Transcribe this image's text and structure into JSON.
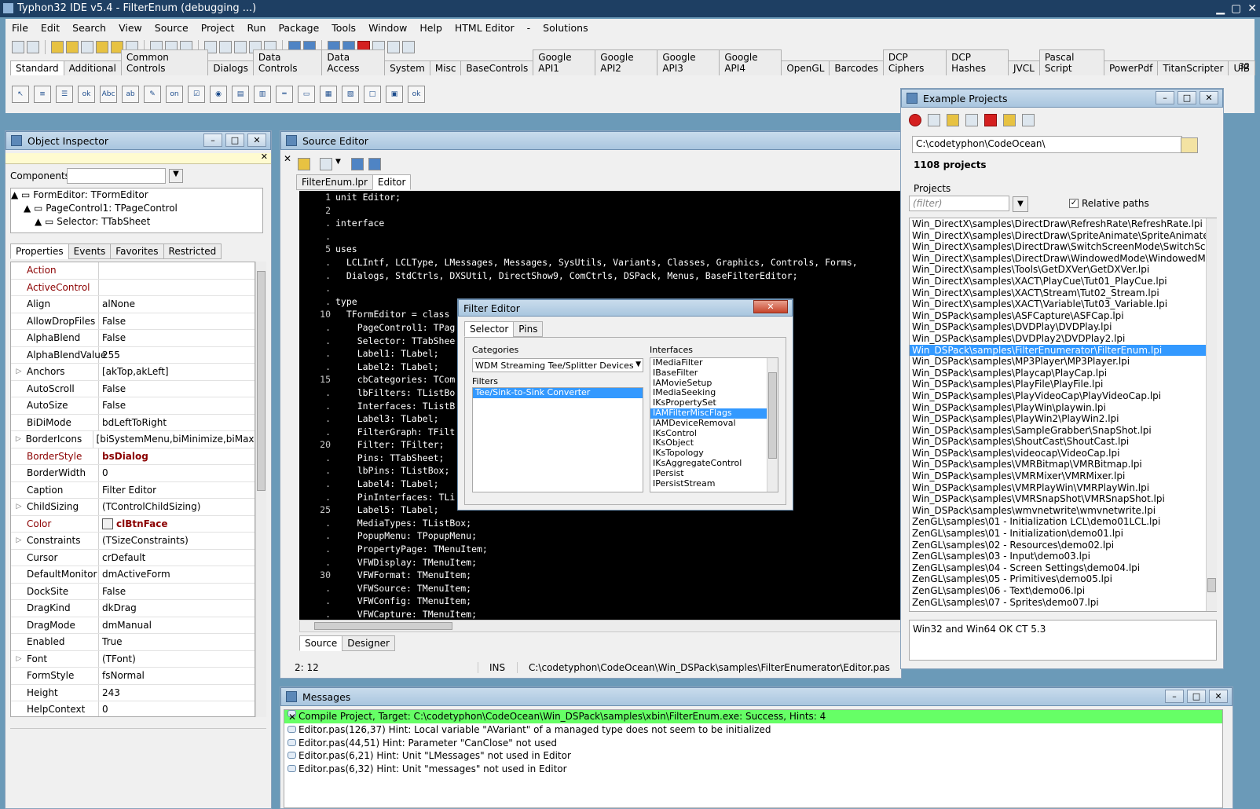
{
  "window_title": "Typhon32 IDE v5.4 - FilterEnum (debugging ...)",
  "menu": [
    "File",
    "Edit",
    "Search",
    "View",
    "Source",
    "Project",
    "Run",
    "Package",
    "Tools",
    "Window",
    "Help",
    "HTML Editor",
    "-",
    "Solutions"
  ],
  "component_tabs": [
    "Standard",
    "Additional",
    "Common Controls",
    "Dialogs",
    "Data Controls",
    "Data Access",
    "System",
    "Misc",
    "BaseControls",
    "Google API1",
    "Google API2",
    "Google API3",
    "Google API4",
    "OpenGL",
    "Barcodes",
    "DCP Ciphers",
    "DCP Hashes",
    "JVCL",
    "Pascal Script",
    "PowerPdf",
    "TitanScripter",
    "UIB"
  ],
  "side_number": "32",
  "object_inspector": {
    "title": "Object Inspector",
    "components_label": "Components",
    "tree": [
      "FormEditor: TFormEditor",
      "PageControl1: TPageControl",
      "Selector: TTabSheet"
    ],
    "tabs": [
      "Properties",
      "Events",
      "Favorites",
      "Restricted"
    ],
    "props": [
      {
        "name": "Action",
        "value": "",
        "red": true,
        "bold": false,
        "exp": false
      },
      {
        "name": "ActiveControl",
        "value": "",
        "red": true,
        "bold": false,
        "exp": false
      },
      {
        "name": "Align",
        "value": "alNone",
        "red": false,
        "bold": false,
        "exp": false
      },
      {
        "name": "AllowDropFiles",
        "value": "False",
        "red": false,
        "bold": false,
        "exp": false
      },
      {
        "name": "AlphaBlend",
        "value": "False",
        "red": false,
        "bold": false,
        "exp": false
      },
      {
        "name": "AlphaBlendValue",
        "value": "255",
        "red": false,
        "bold": false,
        "exp": false
      },
      {
        "name": "Anchors",
        "value": "[akTop,akLeft]",
        "red": false,
        "bold": false,
        "exp": true
      },
      {
        "name": "AutoScroll",
        "value": "False",
        "red": false,
        "bold": false,
        "exp": false
      },
      {
        "name": "AutoSize",
        "value": "False",
        "red": false,
        "bold": false,
        "exp": false
      },
      {
        "name": "BiDiMode",
        "value": "bdLeftToRight",
        "red": false,
        "bold": false,
        "exp": false
      },
      {
        "name": "BorderIcons",
        "value": "[biSystemMenu,biMinimize,biMaxim",
        "red": false,
        "bold": false,
        "exp": true
      },
      {
        "name": "BorderStyle",
        "value": "bsDialog",
        "red": true,
        "bold": true,
        "exp": false
      },
      {
        "name": "BorderWidth",
        "value": "0",
        "red": false,
        "bold": false,
        "exp": false
      },
      {
        "name": "Caption",
        "value": "Filter Editor",
        "red": false,
        "bold": false,
        "exp": false
      },
      {
        "name": "ChildSizing",
        "value": "(TControlChildSizing)",
        "red": false,
        "bold": false,
        "exp": true
      },
      {
        "name": "Color",
        "value": "clBtnFace",
        "red": true,
        "bold": true,
        "exp": false
      },
      {
        "name": "Constraints",
        "value": "(TSizeConstraints)",
        "red": false,
        "bold": false,
        "exp": true
      },
      {
        "name": "Cursor",
        "value": "crDefault",
        "red": false,
        "bold": false,
        "exp": false
      },
      {
        "name": "DefaultMonitor",
        "value": "dmActiveForm",
        "red": false,
        "bold": false,
        "exp": false
      },
      {
        "name": "DockSite",
        "value": "False",
        "red": false,
        "bold": false,
        "exp": false
      },
      {
        "name": "DragKind",
        "value": "dkDrag",
        "red": false,
        "bold": false,
        "exp": false
      },
      {
        "name": "DragMode",
        "value": "dmManual",
        "red": false,
        "bold": false,
        "exp": false
      },
      {
        "name": "Enabled",
        "value": "True",
        "red": false,
        "bold": false,
        "exp": false
      },
      {
        "name": "Font",
        "value": "(TFont)",
        "red": false,
        "bold": false,
        "exp": true
      },
      {
        "name": "FormStyle",
        "value": "fsNormal",
        "red": false,
        "bold": false,
        "exp": false
      },
      {
        "name": "Height",
        "value": "243",
        "red": false,
        "bold": false,
        "exp": false
      },
      {
        "name": "HelpContext",
        "value": "0",
        "red": false,
        "bold": false,
        "exp": false
      }
    ]
  },
  "source_editor": {
    "title": "Source Editor",
    "tabs": [
      "FilterEnum.lpr",
      "Editor"
    ],
    "bottom_tabs": [
      "Source",
      "Designer"
    ],
    "status": {
      "pos": "2: 12",
      "mode": "INS",
      "path": "C:\\codetyphon\\CodeOcean\\Win_DSPack\\samples\\FilterEnumerator\\Editor.pas"
    },
    "lines": [
      {
        "n": "1",
        "t": "unit Editor;"
      },
      {
        "n": "2",
        "t": ""
      },
      {
        "n": ".",
        "t": "interface"
      },
      {
        "n": ".",
        "t": ""
      },
      {
        "n": "5",
        "t": "uses"
      },
      {
        "n": ".",
        "t": "  LCLIntf, LCLType, LMessages, Messages, SysUtils, Variants, Classes, Graphics, Controls, Forms,"
      },
      {
        "n": ".",
        "t": "  Dialogs, StdCtrls, DXSUtil, DirectShow9, ComCtrls, DSPack, Menus, BaseFilterEditor;"
      },
      {
        "n": ".",
        "t": ""
      },
      {
        "n": ".",
        "t": "type"
      },
      {
        "n": "10",
        "t": "  TFormEditor = class"
      },
      {
        "n": ".",
        "t": "    PageControl1: TPag"
      },
      {
        "n": ".",
        "t": "    Selector: TTabShee"
      },
      {
        "n": ".",
        "t": "    Label1: TLabel;"
      },
      {
        "n": ".",
        "t": "    Label2: TLabel;"
      },
      {
        "n": "15",
        "t": "    cbCategories: TCom"
      },
      {
        "n": ".",
        "t": "    lbFilters: TListBo"
      },
      {
        "n": ".",
        "t": "    Interfaces: TListB"
      },
      {
        "n": ".",
        "t": "    Label3: TLabel;"
      },
      {
        "n": ".",
        "t": "    FilterGraph: TFilt"
      },
      {
        "n": "20",
        "t": "    Filter: TFilter;"
      },
      {
        "n": ".",
        "t": "    Pins: TTabSheet;"
      },
      {
        "n": ".",
        "t": "    lbPins: TListBox;"
      },
      {
        "n": ".",
        "t": "    Label4: TLabel;"
      },
      {
        "n": ".",
        "t": "    PinInterfaces: TLi"
      },
      {
        "n": "25",
        "t": "    Label5: TLabel;"
      },
      {
        "n": ".",
        "t": "    MediaTypes: TListBox;"
      },
      {
        "n": ".",
        "t": "    PopupMenu: TPopupMenu;"
      },
      {
        "n": ".",
        "t": "    PropertyPage: TMenuItem;"
      },
      {
        "n": ".",
        "t": "    VFWDisplay: TMenuItem;"
      },
      {
        "n": "30",
        "t": "    VFWFormat: TMenuItem;"
      },
      {
        "n": ".",
        "t": "    VFWSource: TMenuItem;"
      },
      {
        "n": ".",
        "t": "    VFWConfig: TMenuItem;"
      },
      {
        "n": ".",
        "t": "    VFWCapture: TMenuItem;"
      }
    ]
  },
  "filter_editor": {
    "title": "Filter Editor",
    "tabs": [
      "Selector",
      "Pins"
    ],
    "categories_label": "Categories",
    "category_value": "WDM Streaming Tee/Splitter Devices",
    "filters_label": "Filters",
    "filters": [
      "Tee/Sink-to-Sink Converter"
    ],
    "interfaces_label": "Interfaces",
    "interfaces": [
      "IMediaFilter",
      "IBaseFilter",
      "IAMovieSetup",
      "IMediaSeeking",
      "IKsPropertySet",
      "IAMFilterMiscFlags",
      "IAMDeviceRemoval",
      "IKsControl",
      "IKsObject",
      "IKsTopology",
      "IKsAggregateControl",
      "IPersist",
      "IPersistStream"
    ]
  },
  "example_projects": {
    "title": "Example Projects",
    "path": "C:\\codetyphon\\CodeOcean\\",
    "count": "1108 projects",
    "projects_label": "Projects",
    "filter_placeholder": "(filter)",
    "relative_paths": "Relative paths",
    "list": [
      "Win_DirectX\\samples\\DirectDraw\\RefreshRate\\RefreshRate.lpi",
      "Win_DirectX\\samples\\DirectDraw\\SpriteAnimate\\SpriteAnimate.lpi",
      "Win_DirectX\\samples\\DirectDraw\\SwitchScreenMode\\SwitchScreenMoc",
      "Win_DirectX\\samples\\DirectDraw\\WindowedMode\\WindowedMode.lpi",
      "Win_DirectX\\samples\\Tools\\GetDXVer\\GetDXVer.lpi",
      "Win_DirectX\\samples\\XACT\\PlayCue\\Tut01_PlayCue.lpi",
      "Win_DirectX\\samples\\XACT\\Stream\\Tut02_Stream.lpi",
      "Win_DirectX\\samples\\XACT\\Variable\\Tut03_Variable.lpi",
      "Win_DSPack\\samples\\ASFCapture\\ASFCap.lpi",
      "Win_DSPack\\samples\\DVDPlay\\DVDPlay.lpi",
      "Win_DSPack\\samples\\DVDPlay2\\DVDPlay2.lpi",
      "Win_DSPack\\samples\\FilterEnumerator\\FilterEnum.lpi",
      "Win_DSPack\\samples\\MP3Player\\MP3Player.lpi",
      "Win_DSPack\\samples\\Playcap\\PlayCap.lpi",
      "Win_DSPack\\samples\\PlayFile\\PlayFile.lpi",
      "Win_DSPack\\samples\\PlayVideoCap\\PlayVideoCap.lpi",
      "Win_DSPack\\samples\\PlayWin\\playwin.lpi",
      "Win_DSPack\\samples\\PlayWin2\\PlayWin2.lpi",
      "Win_DSPack\\samples\\SampleGrabber\\SnapShot.lpi",
      "Win_DSPack\\samples\\ShoutCast\\ShoutCast.lpi",
      "Win_DSPack\\samples\\videocap\\VideoCap.lpi",
      "Win_DSPack\\samples\\VMRBitmap\\VMRBitmap.lpi",
      "Win_DSPack\\samples\\VMRMixer\\VMRMixer.lpi",
      "Win_DSPack\\samples\\VMRPlayWin\\VMRPlayWin.lpi",
      "Win_DSPack\\samples\\VMRSnapShot\\VMRSnapShot.lpi",
      "Win_DSPack\\samples\\wmvnetwrite\\wmvnetwrite.lpi",
      "ZenGL\\samples\\01 - Initialization LCL\\demo01LCL.lpi",
      "ZenGL\\samples\\01 - Initialization\\demo01.lpi",
      "ZenGL\\samples\\02 - Resources\\demo02.lpi",
      "ZenGL\\samples\\03 - Input\\demo03.lpi",
      "ZenGL\\samples\\04 - Screen Settings\\demo04.lpi",
      "ZenGL\\samples\\05 - Primitives\\demo05.lpi",
      "ZenGL\\samples\\06 - Text\\demo06.lpi",
      "ZenGL\\samples\\07 - Sprites\\demo07.lpi"
    ],
    "selected_project": "Win_DSPack\\samples\\FilterEnumerator\\FilterEnum.lpi",
    "note": "Win32 and Win64 OK CT 5.3"
  },
  "messages": {
    "title": "Messages",
    "lines": [
      {
        "text": "Compile Project, Target: C:\\codetyphon\\CodeOcean\\Win_DSPack\\samples\\xbin\\FilterEnum.exe: Success, Hints: 4",
        "success": true
      },
      {
        "text": "Editor.pas(126,37) Hint: Local variable \"AVariant\" of a managed type does not seem to be initialized",
        "success": false
      },
      {
        "text": "Editor.pas(44,51) Hint: Parameter \"CanClose\" not used",
        "success": false
      },
      {
        "text": "Editor.pas(6,21) Hint: Unit \"LMessages\" not used in Editor",
        "success": false
      },
      {
        "text": "Editor.pas(6,32) Hint: Unit \"messages\" not used in Editor",
        "success": false
      }
    ]
  }
}
